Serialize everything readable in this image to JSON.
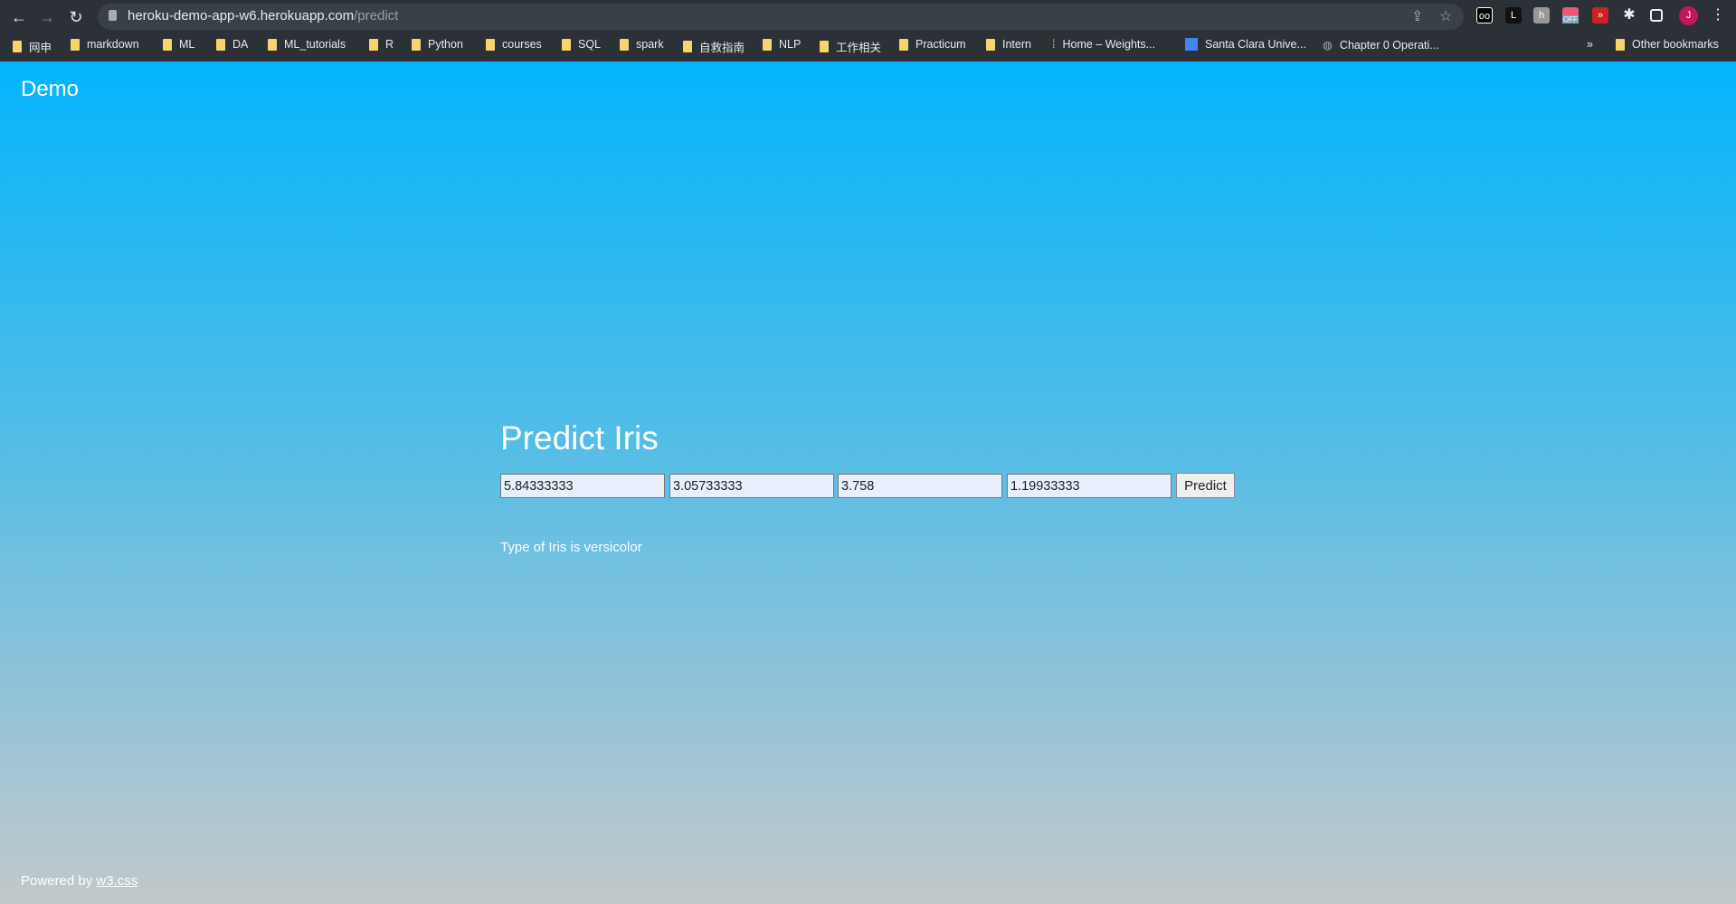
{
  "browser": {
    "url_host": "heroku-demo-app-w6.herokuapp.com",
    "url_path": "/predict",
    "avatar_letter": "J",
    "ext_off_label": "OFF",
    "bookmarks": [
      "网申",
      "markdown",
      "ML",
      "DA",
      "ML_tutorials",
      "R",
      "Python",
      "courses",
      "SQL",
      "spark",
      "自救指南",
      "NLP",
      "工作相关",
      "Practicum",
      "Intern",
      "Home – Weights...",
      "Santa Clara Unive...",
      "Chapter 0 Operati..."
    ],
    "more": "»",
    "other_bookmarks": "Other bookmarks"
  },
  "app": {
    "brand": "Demo",
    "title": "Predict Iris",
    "inputs": [
      "5.84333333",
      "3.05733333",
      "3.758",
      "1.19933333"
    ],
    "predict_label": "Predict",
    "result": "Type of Iris is versicolor",
    "footer_prefix": "Powered by ",
    "footer_link": "w3.css"
  }
}
